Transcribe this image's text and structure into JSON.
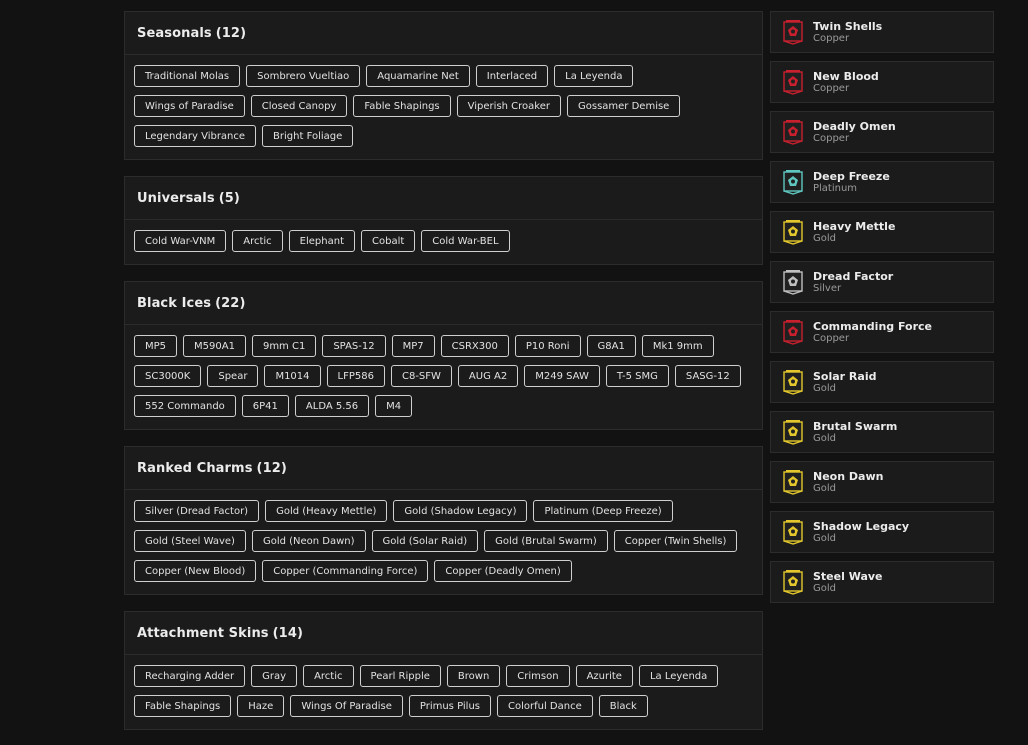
{
  "sections": [
    {
      "title": "Seasonals",
      "count": "(12)",
      "items": [
        "Traditional Molas",
        "Sombrero Vueltiao",
        "Aquamarine Net",
        "Interlaced",
        "La Leyenda",
        "Wings of Paradise",
        "Closed Canopy",
        "Fable Shapings",
        "Viperish Croaker",
        "Gossamer Demise",
        "Legendary Vibrance",
        "Bright Foliage"
      ]
    },
    {
      "title": "Universals",
      "count": "(5)",
      "items": [
        "Cold War-VNM",
        "Arctic",
        "Elephant",
        "Cobalt",
        "Cold War-BEL"
      ]
    },
    {
      "title": "Black Ices",
      "count": "(22)",
      "items": [
        "MP5",
        "M590A1",
        "9mm C1",
        "SPAS-12",
        "MP7",
        "CSRX300",
        "P10 Roni",
        "G8A1",
        "Mk1 9mm",
        "SC3000K",
        "Spear",
        "M1014",
        "LFP586",
        "C8-SFW",
        "AUG A2",
        "M249 SAW",
        "T-5 SMG",
        "SASG-12",
        "552 Commando",
        "6P41",
        "ALDA 5.56",
        "M4"
      ]
    },
    {
      "title": "Ranked Charms",
      "count": "(12)",
      "items": [
        "Silver (Dread Factor)",
        "Gold (Heavy Mettle)",
        "Gold (Shadow Legacy)",
        "Platinum (Deep Freeze)",
        "Gold (Steel Wave)",
        "Gold (Neon Dawn)",
        "Gold (Solar Raid)",
        "Gold (Brutal Swarm)",
        "Copper (Twin Shells)",
        "Copper (New Blood)",
        "Copper (Commanding Force)",
        "Copper (Deadly Omen)"
      ]
    },
    {
      "title": "Attachment Skins",
      "count": "(14)",
      "items": [
        "Recharging Adder",
        "Gray",
        "Arctic",
        "Pearl Ripple",
        "Brown",
        "Crimson",
        "Azurite",
        "La Leyenda",
        "Fable Shapings",
        "Haze",
        "Wings Of Paradise",
        "Primus Pilus",
        "Colorful Dance",
        "Black"
      ]
    }
  ],
  "charms": [
    {
      "name": "Twin Shells",
      "tier": "Copper",
      "color": "#c8202e",
      "icon": "copper-rank-charm-icon"
    },
    {
      "name": "New Blood",
      "tier": "Copper",
      "color": "#c8202e",
      "icon": "copper-rank-charm-icon"
    },
    {
      "name": "Deadly Omen",
      "tier": "Copper",
      "color": "#c8202e",
      "icon": "copper-rank-charm-icon"
    },
    {
      "name": "Deep Freeze",
      "tier": "Platinum",
      "color": "#5fc7c0",
      "icon": "platinum-rank-charm-icon"
    },
    {
      "name": "Heavy Mettle",
      "tier": "Gold",
      "color": "#e3c72c",
      "icon": "gold-rank-charm-icon"
    },
    {
      "name": "Dread Factor",
      "tier": "Silver",
      "color": "#bfbfbf",
      "icon": "silver-rank-charm-icon"
    },
    {
      "name": "Commanding Force",
      "tier": "Copper",
      "color": "#c8202e",
      "icon": "copper-rank-charm-icon"
    },
    {
      "name": "Solar Raid",
      "tier": "Gold",
      "color": "#e3c72c",
      "icon": "gold-rank-charm-icon"
    },
    {
      "name": "Brutal Swarm",
      "tier": "Gold",
      "color": "#e3c72c",
      "icon": "gold-rank-charm-icon"
    },
    {
      "name": "Neon Dawn",
      "tier": "Gold",
      "color": "#e3c72c",
      "icon": "gold-rank-charm-icon"
    },
    {
      "name": "Shadow Legacy",
      "tier": "Gold",
      "color": "#e3c72c",
      "icon": "gold-rank-charm-icon"
    },
    {
      "name": "Steel Wave",
      "tier": "Gold",
      "color": "#e3c72c",
      "icon": "gold-rank-charm-icon"
    }
  ]
}
